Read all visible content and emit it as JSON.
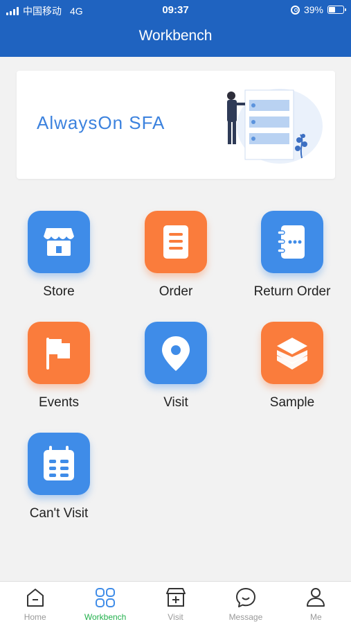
{
  "status": {
    "carrier": "中国移动",
    "network": "4G",
    "time": "09:37",
    "battery": "39%"
  },
  "header": {
    "title": "Workbench"
  },
  "banner": {
    "text": "AlwaysOn SFA"
  },
  "grid": [
    {
      "label": "Store",
      "icon": "store-icon",
      "color": "blue"
    },
    {
      "label": "Order",
      "icon": "order-document-icon",
      "color": "orange"
    },
    {
      "label": "Return Order",
      "icon": "notebook-icon",
      "color": "blue"
    },
    {
      "label": "Events",
      "icon": "flag-icon",
      "color": "orange"
    },
    {
      "label": "Visit",
      "icon": "location-pin-icon",
      "color": "blue"
    },
    {
      "label": "Sample",
      "icon": "layers-icon",
      "color": "orange"
    },
    {
      "label": "Can't Visit",
      "icon": "calendar-icon",
      "color": "blue"
    }
  ],
  "tabbar": [
    {
      "label": "Home",
      "icon": "home-icon",
      "active": false
    },
    {
      "label": "Workbench",
      "icon": "grid-icon",
      "active": true
    },
    {
      "label": "Visit",
      "icon": "store-plus-icon",
      "active": false
    },
    {
      "label": "Message",
      "icon": "chat-smile-icon",
      "active": false
    },
    {
      "label": "Me",
      "icon": "person-icon",
      "active": false
    }
  ],
  "colors": {
    "header": "#1f63c0",
    "blue_tile": "#3f8ce8",
    "orange_tile": "#fa7c3c",
    "active_tab": "#22b14c"
  }
}
